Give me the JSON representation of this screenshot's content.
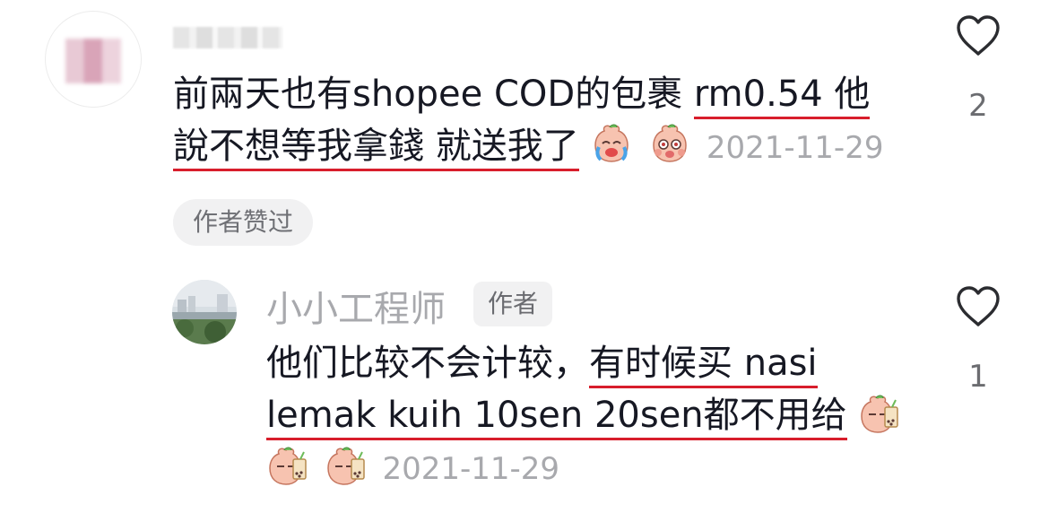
{
  "comment": {
    "text_line1_a": "前兩天也有shopee COD的包裹",
    "text_line1_b": "rm0.54 他",
    "text_line2_a": "說不想等我拿錢 就送我了",
    "timestamp": "2021-11-29",
    "like_count": "2",
    "author_liked_label": "作者赞过"
  },
  "reply": {
    "username": "小小工程师",
    "author_tag": "作者",
    "text_line1_a": "他们比较不会计较，",
    "text_line1_b": "有时候买 nasi",
    "text_line2": "lemak kuih 10sen 20sen都不用给",
    "timestamp": "2021-11-29",
    "like_count": "1"
  },
  "icons": {
    "like": "heart-outline-icon",
    "emoji_crying": "crying-peach-emoji",
    "emoji_shocked": "shocked-peach-emoji",
    "emoji_drink": "peach-bubble-tea-emoji"
  },
  "colors": {
    "text": "#161823",
    "muted": "#a8a9ad",
    "underline": "#d81e2c",
    "chip_bg": "#f1f1f2"
  }
}
